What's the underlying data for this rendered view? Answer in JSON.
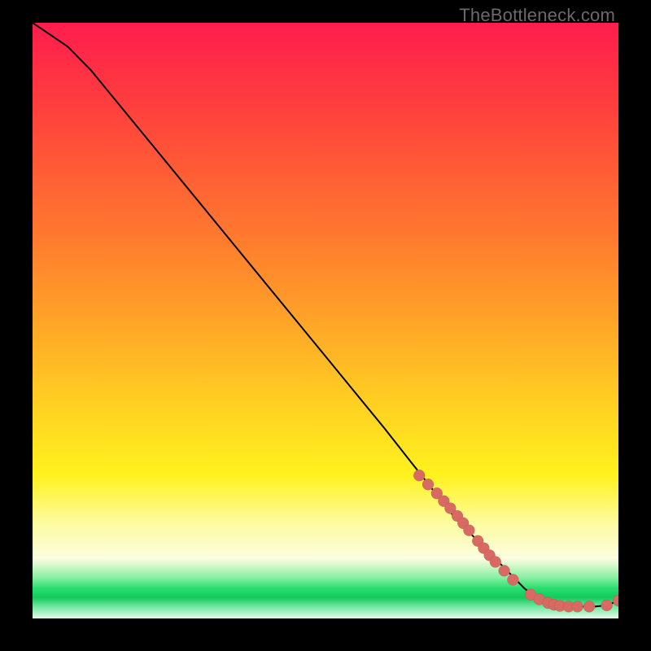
{
  "watermark": "TheBottleneck.com",
  "colors": {
    "background": "#000000",
    "curve": "#000000",
    "marker": "#d96a63",
    "gradient_top": "#ff1d4d",
    "gradient_mid": "#fff21e",
    "gradient_band": "#26dd6e"
  },
  "chart_data": {
    "type": "line",
    "title": "",
    "xlabel": "",
    "ylabel": "",
    "xlim": [
      0,
      100
    ],
    "ylim": [
      0,
      100
    ],
    "grid": false,
    "legend": false,
    "series": [
      {
        "name": "curve",
        "x": [
          0,
          3,
          6,
          10,
          15,
          20,
          30,
          40,
          50,
          60,
          68,
          72,
          76,
          80,
          84,
          86,
          88,
          90,
          92,
          94,
          96,
          98,
          100
        ],
        "y": [
          100,
          98,
          96,
          92,
          86,
          80,
          68,
          56,
          44,
          32,
          22,
          17,
          13,
          9,
          5,
          3.5,
          2.5,
          2,
          2,
          2,
          2,
          2.2,
          3
        ]
      }
    ],
    "markers": {
      "name": "highlighted-points",
      "x": [
        66,
        67.5,
        69,
        70.2,
        71.3,
        72.5,
        73.5,
        74.5,
        76,
        77,
        78,
        79,
        80.5,
        82,
        85,
        86.5,
        88,
        89,
        90,
        91.5,
        93,
        95,
        98,
        100
      ],
      "y": [
        24,
        22.5,
        21,
        19.7,
        18.5,
        17.2,
        16,
        14.8,
        13,
        11.8,
        10.6,
        9.5,
        8,
        6.5,
        4,
        3.2,
        2.6,
        2.3,
        2.1,
        2,
        2,
        2,
        2.2,
        3
      ]
    }
  }
}
